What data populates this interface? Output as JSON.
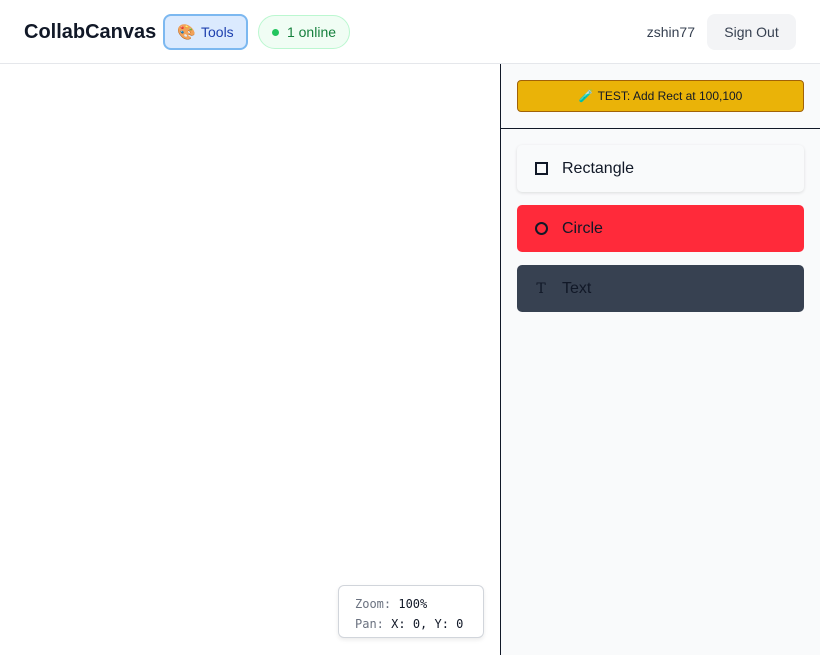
{
  "header": {
    "app_title": "CollabCanvas",
    "tools_button": {
      "icon": "🎨",
      "label": "Tools"
    },
    "online_badge": {
      "label": "1 online",
      "status_color": "#22c55e"
    },
    "username": "zshin77",
    "sign_out_label": "Sign Out"
  },
  "canvas": {
    "zoom_panel": {
      "zoom_label": "Zoom:",
      "zoom_value": "100%",
      "pan_label": "Pan:",
      "pan_value": "X: 0, Y: 0"
    }
  },
  "sidebar": {
    "test_button": {
      "icon": "🧪",
      "label": "TEST: Add Rect at 100,100",
      "color": "#eab308"
    },
    "tools": [
      {
        "label": "Rectangle",
        "icon": "square-icon",
        "color": "#f9fafb"
      },
      {
        "label": "Circle",
        "icon": "circle-icon",
        "color": "#ff2a3a"
      },
      {
        "label": "Text",
        "icon": "text-icon",
        "glyph": "T",
        "color": "#374151"
      }
    ]
  }
}
